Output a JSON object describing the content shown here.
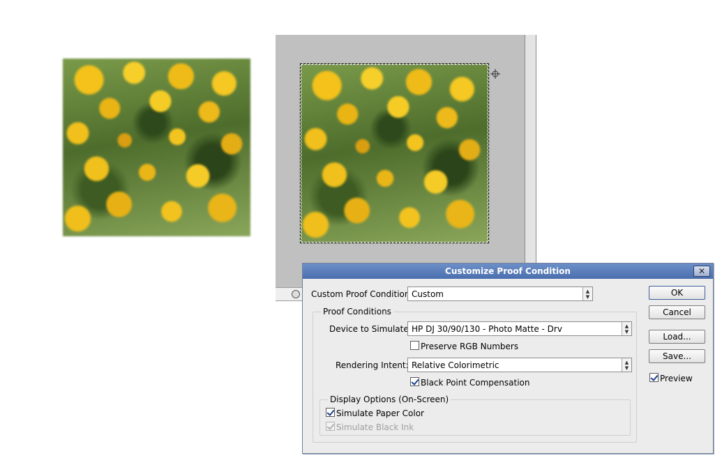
{
  "dialog": {
    "title": "Customize Proof Condition",
    "close_label": "✕",
    "custom_proof_condition": {
      "label": "Custom Proof Condition:",
      "value": "Custom"
    },
    "proof_conditions": {
      "group_title": "Proof Conditions",
      "device_label": "Device to Simulate:",
      "device_value": "HP DJ 30/90/130 - Photo Matte - Drv",
      "preserve_rgb_label": "Preserve RGB Numbers",
      "preserve_rgb_checked": false,
      "rendering_intent_label": "Rendering Intent:",
      "rendering_intent_value": "Relative Colorimetric",
      "black_point_label": "Black Point Compensation",
      "black_point_checked": true
    },
    "display_options": {
      "group_title": "Display Options (On-Screen)",
      "simulate_paper_label": "Simulate Paper Color",
      "simulate_paper_checked": true,
      "simulate_ink_label": "Simulate Black Ink",
      "simulate_ink_checked": true,
      "simulate_ink_disabled": true
    },
    "buttons": {
      "ok": "OK",
      "cancel": "Cancel",
      "load": "Load...",
      "save": "Save..."
    },
    "preview_label": "Preview",
    "preview_checked": true
  },
  "icons": {
    "crosshair": "crosshair-icon",
    "status": "status-icon",
    "dropdown": "updown-arrow-icon"
  },
  "colors": {
    "title_bar": "#4a6fae",
    "dialog_bg": "#ececec",
    "canvas_bg": "#c0c0c0"
  }
}
